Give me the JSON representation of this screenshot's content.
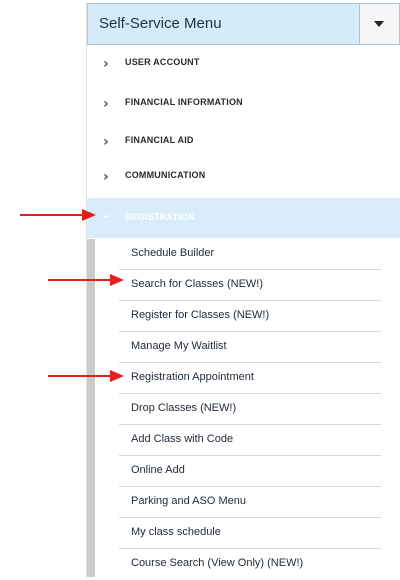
{
  "menu": {
    "title": "Self-Service Menu",
    "sections": [
      {
        "label": "USER ACCOUNT"
      },
      {
        "label": "FINANCIAL INFORMATION"
      },
      {
        "label": "FINANCIAL AID"
      },
      {
        "label": "COMMUNICATION"
      },
      {
        "label": "REGISTRATION"
      }
    ],
    "registration_items": [
      {
        "label": "Schedule Builder"
      },
      {
        "label": "Search for Classes (NEW!)"
      },
      {
        "label": "Register for Classes (NEW!)"
      },
      {
        "label": "Manage My Waitlist"
      },
      {
        "label": "Registration Appointment"
      },
      {
        "label": "Drop Classes (NEW!)"
      },
      {
        "label": "Add Class with Code"
      },
      {
        "label": "Online Add"
      },
      {
        "label": "Parking and ASO Menu"
      },
      {
        "label": "My class schedule"
      },
      {
        "label": "Course Search (View Only) (NEW!)"
      }
    ]
  },
  "colors": {
    "header_bg": "#d6ebf8",
    "active_section_bg": "#d8ecfa",
    "annotation_arrow": "#e0201c"
  },
  "icons": {
    "dropdown": "caret-down-icon",
    "collapsed_section": "chevron-right-icon",
    "expanded_section": "chevron-down-icon"
  }
}
